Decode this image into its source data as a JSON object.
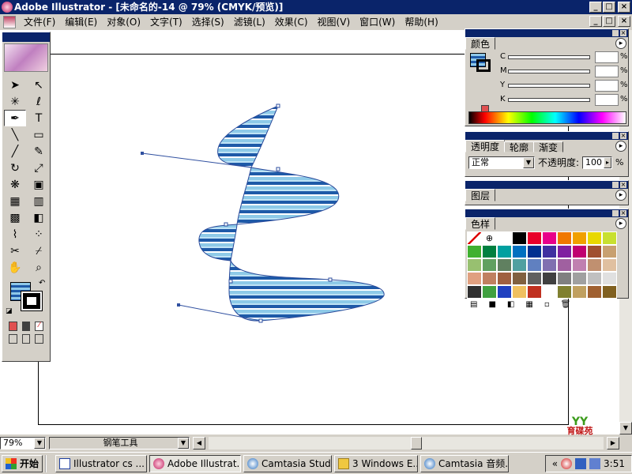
{
  "window": {
    "title": "Adobe Illustrator - [未命名的-14 @ 79% (CMYK/预览)]",
    "controls": {
      "min": "_",
      "max": "□",
      "close": "×"
    }
  },
  "menu": [
    {
      "label": "文件(F)"
    },
    {
      "label": "编辑(E)"
    },
    {
      "label": "对象(O)"
    },
    {
      "label": "文字(T)"
    },
    {
      "label": "选择(S)"
    },
    {
      "label": "滤镜(L)"
    },
    {
      "label": "效果(C)"
    },
    {
      "label": "视图(V)"
    },
    {
      "label": "窗口(W)"
    },
    {
      "label": "帮助(H)"
    }
  ],
  "panels": {
    "color": {
      "tab": "颜色",
      "rows": [
        {
          "label": "C"
        },
        {
          "label": "M"
        },
        {
          "label": "Y"
        },
        {
          "label": "K"
        }
      ],
      "pct": "%"
    },
    "transparency": {
      "tabs": [
        "透明度",
        "轮廓",
        "渐变"
      ],
      "mode": "正常",
      "opacity_label": "不透明度:",
      "opacity_value": "100",
      "pct": "%"
    },
    "layers": {
      "tab": "图层"
    },
    "swatches": {
      "tab": "色样",
      "colors": [
        "#ffffff",
        "#ffffff",
        "#ffffff",
        "#000000",
        "#e8002a",
        "#e8008a",
        "#f07800",
        "#f0a000",
        "#e8d800",
        "#c8e030",
        "#40b030",
        "#008040",
        "#00a0a0",
        "#0070c0",
        "#003090",
        "#4030a0",
        "#8020a0",
        "#c00070",
        "#a05030",
        "#c8a070",
        "#98c070",
        "#60a060",
        "#608060",
        "#50a0a0",
        "#6080c0",
        "#8070b0",
        "#a060a0",
        "#c080b0",
        "#c09070",
        "#e0c0a0",
        "#e0a080",
        "#c08060",
        "#a06040",
        "#806040",
        "#606060",
        "#404040",
        "#808080",
        "#a0a0a0",
        "#c0c0c0",
        "#e0e0e0",
        "#303030",
        "#40a040",
        "#2040c0",
        "#f0c060",
        "#c03020",
        "#ffffff",
        "#808030",
        "#c0a060",
        "#a06030",
        "#806020"
      ]
    }
  },
  "status": {
    "zoom": "79%",
    "tool": "钢笔工具"
  },
  "taskbar": {
    "start": "开始",
    "items": [
      {
        "label": "Illustrator cs ..."
      },
      {
        "label": "Adobe Illustrat..."
      },
      {
        "label": "Camtasia Studi..."
      },
      {
        "label": "3 Windows E..."
      },
      {
        "label": "Camtasia 音频..."
      }
    ],
    "time": "3:51"
  },
  "watermark": "育碟苑"
}
